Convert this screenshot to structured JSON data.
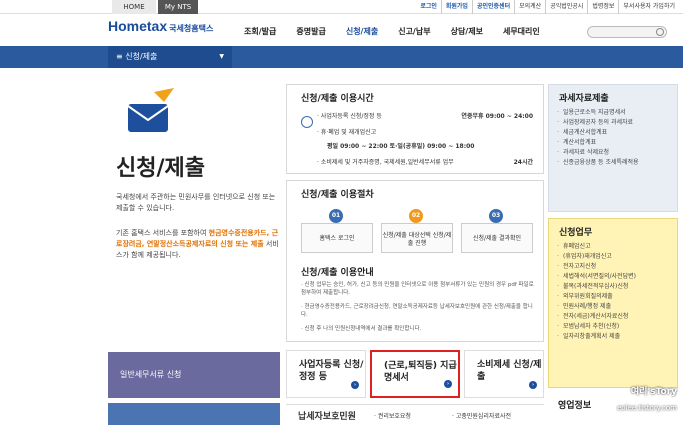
{
  "topbar": {
    "home": "HOME",
    "mynts": "My NTS",
    "links": [
      "로그인",
      "회원가입",
      "공인인증센터",
      "모의계산",
      "공익법인공시",
      "법령정보",
      "부서사용자 가입하기"
    ]
  },
  "header": {
    "logo": "Hometax",
    "logo_sub": "국세청홈택스",
    "nav": [
      "조회/발급",
      "증명발급",
      "신청/제출",
      "신고/납부",
      "상담/제보",
      "세무대리인"
    ]
  },
  "breadcrumb": {
    "current": "신청/제출"
  },
  "left": {
    "title": "신청/제출",
    "desc1": "국세청에서 주관하는 민원사무를 인터넷으로 신청 또는 제출할 수 있습니다.",
    "desc2_prefix": "기존 홈택스 서비스를 포함하여",
    "desc2_hl": "현금영수증전용카드, 근로장려금, 연말정산소득공제자료의 신청 또는 제출",
    "desc2_suffix": "서비스가 함께 제공됩니다.",
    "btn1": "일반세무서류 신청"
  },
  "time_panel": {
    "title": "신청/제출 이용시간",
    "row1_label": "· 사업자등록 신청/정정 등",
    "row1_value": "연중무휴 09:00 ~ 24:00",
    "row2_label": "· 휴·폐업 및 재개업신고",
    "row2_value": "평일 09:00 ~ 22:00 토·일(공휴일) 09:00 ~ 18:00",
    "row3_label": "· 소비제세 및 거주자증명, 국제세원,일반세무서류 업무",
    "row3_value": "24시간"
  },
  "proc_panel": {
    "title": "신청/제출 이용절차",
    "steps": [
      {
        "num": "01",
        "label": "홈택스 로그인"
      },
      {
        "num": "02",
        "label": "신청/제출 대상선택 신청/제출 진행"
      },
      {
        "num": "03",
        "label": "신청/제출 결과확인"
      }
    ],
    "guide_title": "신청/제출 이용안내",
    "guide": [
      "· 신청 업무는 승인, 허가, 신고 등의 민원을 인터넷으로 이용 첨부서류가 있는 민원의 경우 pdf 파일로 첨부하여 제출합니다.",
      "· 현금영수증전용카드, 근로장려금신청, 연말소득공제자료등 납세자보호민원에 관한 신청/제출을 합니다.",
      "· 신청 후 나의 민원신청내역에서 결과를 확인합니다."
    ]
  },
  "tiles": [
    {
      "label": "사업자등록 신청/정정 등"
    },
    {
      "label": "(근로,퇴직등) 지급명세서"
    },
    {
      "label": "소비제세 신청/제출"
    }
  ],
  "bottom": {
    "label": "납세자보호민원",
    "sub1": "· 권리보호요청",
    "sub2": "· 고충민원심리자료사전"
  },
  "right": {
    "box1_title": "과세자료제출",
    "box1_items": [
      "일용근로소득 지급명세서",
      "사업장제공자 등의 과세자료",
      "세금계산서합계표",
      "계산서합계표",
      "과세자료 삭제요청",
      "신종금융상품 등 조세특례적용"
    ],
    "box2_title": "신청업무",
    "box2_items": [
      "휴폐업신고",
      "(휴업자)재개업신고",
      "전자고지신청",
      "세법해석(서면질의/사전답변)",
      "불복(과세전적부심사)신청",
      "외부위원회질의제출",
      "민원사례/행정 제출",
      "전자(세금)계산서자료신청",
      "모범납세자 추천(신청)",
      "일자리창출계획서 제출"
    ],
    "box3_title": "영업정보"
  },
  "watermark": {
    "name": "여리'sTory",
    "url": "eolee.tistory.com"
  },
  "colors": {
    "brand": "#1a4c9c",
    "accent_orange": "#ef7f1a",
    "highlight_red": "#e02020",
    "yellow_box": "#fff3b5"
  }
}
